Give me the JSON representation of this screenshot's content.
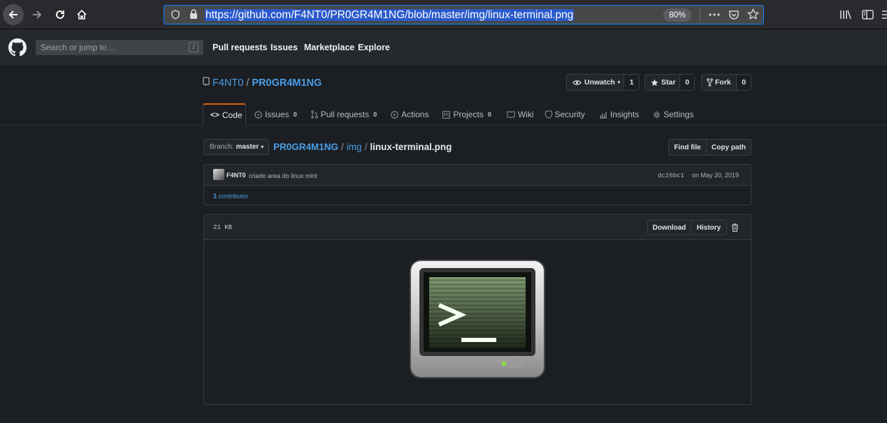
{
  "browser": {
    "url": "https://github.com/F4NT0/PR0GR4M1NG/blob/master/img/linux-terminal.png",
    "zoom": "80%"
  },
  "header": {
    "search_placeholder": "Search or jump to…",
    "search_hint": "/",
    "nav": [
      "Pull requests",
      "Issues",
      "Marketplace",
      "Explore"
    ]
  },
  "repo": {
    "owner": "F4NT0",
    "separator": "/",
    "name": "PR0GR4M1NG",
    "unwatch_label": "Unwatch",
    "watch_count": "1",
    "star_label": "Star",
    "star_count": "0",
    "fork_label": "Fork",
    "fork_count": "0"
  },
  "tabs": [
    {
      "label": "Code",
      "count": ""
    },
    {
      "label": "Issues",
      "count": "0"
    },
    {
      "label": "Pull requests",
      "count": "0"
    },
    {
      "label": "Actions",
      "count": ""
    },
    {
      "label": "Projects",
      "count": "0"
    },
    {
      "label": "Wiki",
      "count": ""
    },
    {
      "label": "Security",
      "count": ""
    },
    {
      "label": "Insights",
      "count": ""
    },
    {
      "label": "Settings",
      "count": ""
    }
  ],
  "breadcrumb": {
    "branch_prefix": "Branch:",
    "branch": "master",
    "root": "PR0GR4M1NG",
    "dir": "img",
    "file": "linux-terminal.png",
    "find_file": "Find file",
    "copy_path": "Copy path"
  },
  "commit": {
    "author": "F4NT0",
    "message": "criado area do linux mint",
    "sha": "dc26bc1",
    "date": "on May 20, 2019",
    "contributors_count": "1",
    "contributors_label": "contributor"
  },
  "file": {
    "size": "21 KB",
    "download": "Download",
    "history": "History"
  }
}
